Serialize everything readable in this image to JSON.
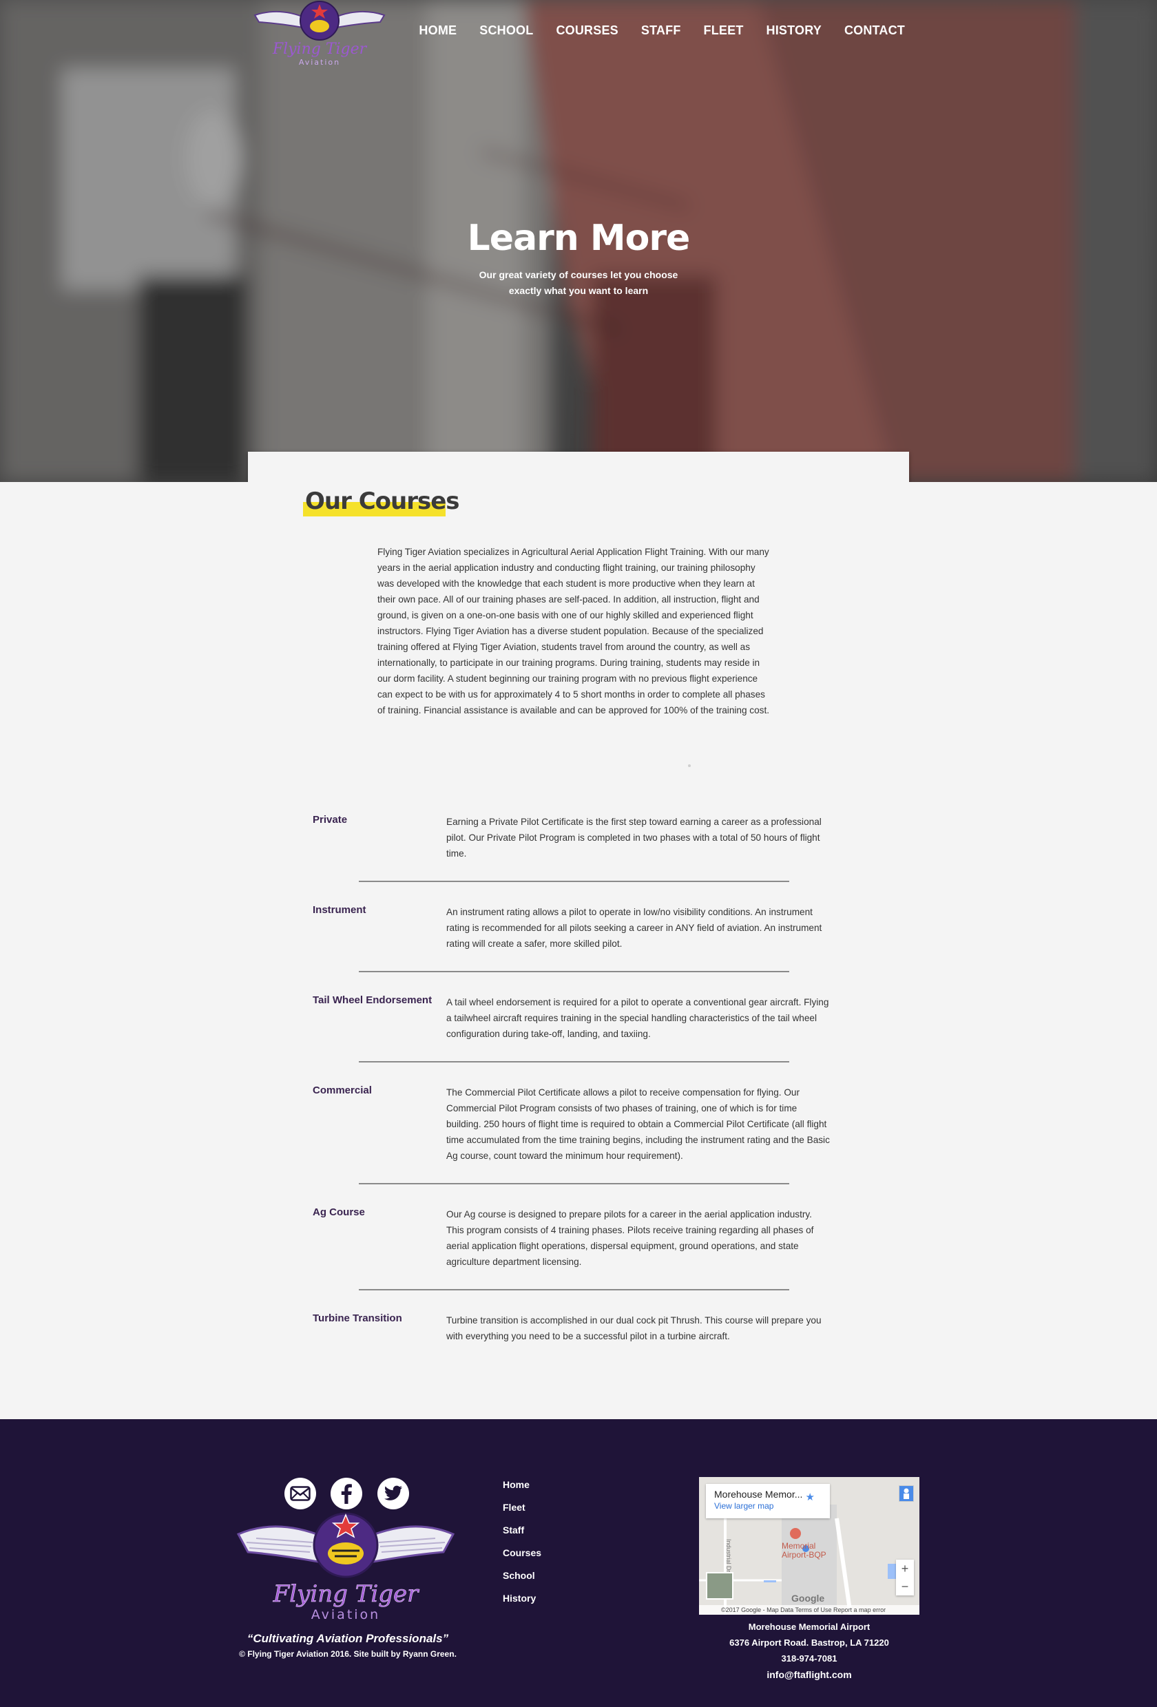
{
  "brand": {
    "name": "Flying Tiger",
    "sub": "Aviation"
  },
  "nav": {
    "items": [
      "HOME",
      "SCHOOL",
      "COURSES",
      "STAFF",
      "FLEET",
      "HISTORY",
      "CONTACT"
    ]
  },
  "hero": {
    "title": "Learn More",
    "subtitle": "Our great variety of courses let you choose exactly what you want to learn"
  },
  "main": {
    "heading": "Our Courses",
    "intro": "Flying Tiger Aviation specializes in Agricultural Aerial Application Flight Training. With our many years in the aerial application industry and conducting flight training, our training philosophy was developed with the knowledge that each student is more productive when they learn at their own pace. All of our training phases are self-paced. In addition, all instruction, flight and ground, is given on a one-on-one basis with one of our highly skilled and experienced flight instructors. Flying Tiger Aviation has a diverse student population. Because of the specialized training offered at Flying Tiger Aviation, students travel from around the country, as well as internationally, to participate in our training programs. During training, students may reside in our dorm facility. A student beginning our training program with no previous flight experience can expect to be with us for approximately 4 to 5 short months in order to complete all phases of training. Financial assistance is available and can be approved for 100% of the training cost.",
    "courses": [
      {
        "name": "Private",
        "desc": "Earning a Private Pilot Certificate is the first step toward earning a career as a professional pilot. Our Private Pilot Program is completed in two phases with a total of 50 hours of flight time."
      },
      {
        "name": "Instrument",
        "desc": "An instrument rating allows a pilot to operate in low/no visibility conditions. An instrument rating is recommended for all pilots seeking a career in ANY field of aviation. An instrument rating will create a safer, more skilled pilot."
      },
      {
        "name": "Tail Wheel Endorsement",
        "desc": "A tail wheel endorsement is required for a pilot to operate a conventional gear aircraft. Flying a tailwheel aircraft requires training in the special handling characteristics of the tail wheel configuration during take-off, landing, and taxiing."
      },
      {
        "name": "Commercial",
        "desc": "The Commercial Pilot Certificate allows a pilot to receive compensation for flying. Our Commercial Pilot Program consists of two phases of training, one of which is for time building. 250 hours of flight time is required to obtain a Commercial Pilot Certificate (all flight time accumulated from the time training begins, including the instrument rating and the Basic Ag course, count toward the minimum hour requirement)."
      },
      {
        "name": "Ag Course",
        "desc": "Our Ag course is designed to prepare pilots for a career in the aerial application industry. This program consists of 4 training phases. Pilots receive training regarding all phases of aerial application flight operations, dispersal equipment, ground operations, and state agriculture department licensing."
      },
      {
        "name": "Turbine Transition",
        "desc": "Turbine transition is accomplished in our dual cock pit Thrush. This course will prepare you with everything you need to be a successful pilot in a turbine aircraft."
      }
    ]
  },
  "footer": {
    "tagline": "“Cultivating Aviation Professionals”",
    "copyright_prefix": "© Flying Tiger Aviation 2016. Site built by ",
    "copyright_author": "Ryann Green.",
    "links": [
      "Home",
      "Fleet",
      "Staff",
      "Courses",
      "School",
      "History"
    ],
    "map": {
      "place": "Morehouse Memor...",
      "link": "View larger map",
      "pin_label_1": "Memorial",
      "pin_label_2": "Airport-BQP",
      "street": "Industrial Dr",
      "attribution": "©2017 Google - Map Data   Terms of Use   Report a map error",
      "logo": "Google",
      "zoom_in": "+",
      "zoom_out": "−"
    },
    "address": {
      "name": "Morehouse Memorial Airport",
      "street": "6376 Airport Road. Bastrop, LA 71220",
      "phone": "318-974-7081",
      "email": "info@ftaflight.com"
    }
  },
  "colors": {
    "footer_bg": "#1f1438",
    "accent_yellow": "#f5e12b",
    "course_name": "#3a2450"
  }
}
